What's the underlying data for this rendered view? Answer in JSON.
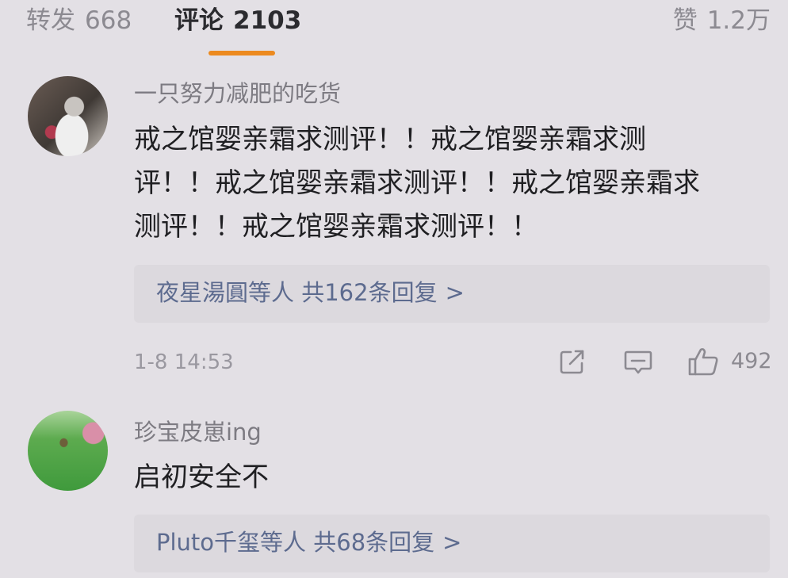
{
  "tabs": {
    "repost": {
      "label": "转发",
      "count": "668"
    },
    "comments": {
      "label": "评论",
      "count": "2103"
    },
    "likes": {
      "label": "赞",
      "count": "1.2万"
    }
  },
  "accent_color": "#ec8a1f",
  "comments": [
    {
      "username": "一只努力减肥的吃货",
      "text_lines": [
        "戒之馆婴亲霜求测评！！戒之馆婴亲霜求测",
        "评！！戒之馆婴亲霜求测评！！戒之馆婴亲霜求",
        "测评！！戒之馆婴亲霜求测评！！",
        ""
      ],
      "replies": {
        "summary": "夜星湯圓等人 共162条回复",
        "arrow": ">"
      },
      "timestamp": "1-8 14:53",
      "likes": "492",
      "icons": [
        "share-icon",
        "comment-icon",
        "thumbs-up-icon"
      ]
    },
    {
      "username": "珍宝皮崽ing",
      "text_lines": [
        "启初安全不"
      ],
      "replies": {
        "summary": "Pluto千玺等人 共68条回复",
        "arrow": ">"
      }
    }
  ]
}
